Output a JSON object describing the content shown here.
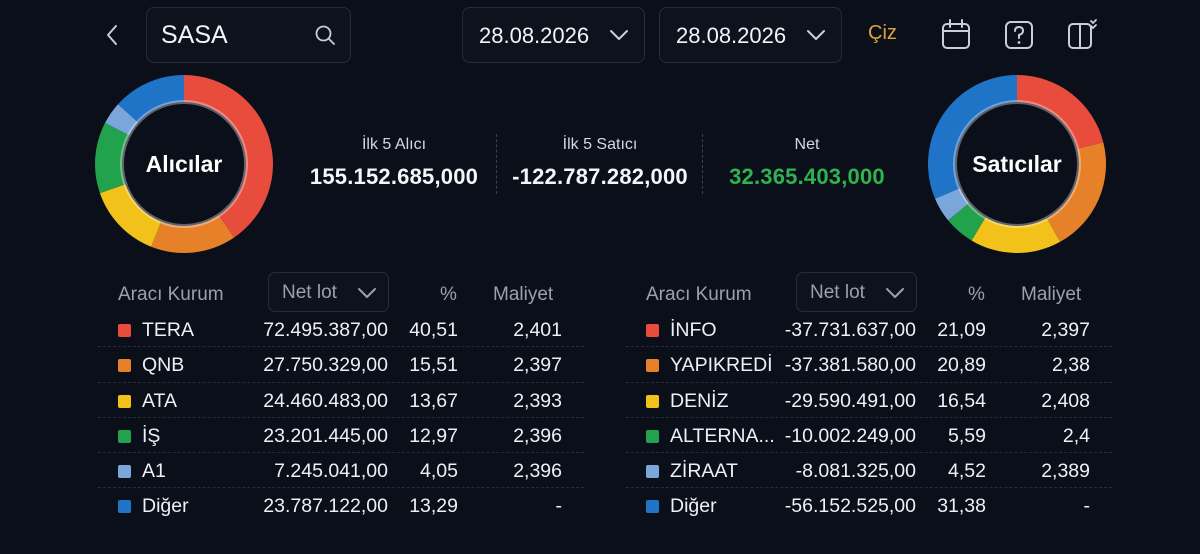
{
  "search": {
    "value": "SASA",
    "placeholder": ""
  },
  "dates": {
    "start": "28.08.2026",
    "end": "28.08.2026"
  },
  "actions": {
    "draw_label": "Çiz"
  },
  "icons": {
    "back": "chevron-left-icon",
    "search": "search-icon",
    "chevron": "chevron-down-icon",
    "calendar": "calendar-icon",
    "help": "help-icon",
    "layout": "layout-toggle-icon"
  },
  "colors": {
    "red": "#e84c3d",
    "orange": "#e6812a",
    "yellow": "#f2c21a",
    "green": "#23a24d",
    "light_blue": "#7aa6db",
    "blue": "#1f74c8",
    "accent_gold": "#d9a63a",
    "net_green": "#2fb24f"
  },
  "summary": {
    "buyers_label": "Alıcılar",
    "sellers_label": "Satıcılar",
    "top5_buyers_label": "İlk 5 Alıcı",
    "top5_buyers_value": "155.152.685,000",
    "top5_sellers_label": "İlk 5 Satıcı",
    "top5_sellers_value": "-122.787.282,000",
    "net_label": "Net",
    "net_value": "32.365.403,000"
  },
  "table_headers": {
    "broker": "Aracı Kurum",
    "net_lot": "Net lot",
    "percent": "%",
    "cost": "Maliyet"
  },
  "buyers": [
    {
      "name": "TERA",
      "net_lot": "72.495.387,00",
      "percent": "40,51",
      "cost": "2,401",
      "color": "#e84c3d",
      "pct": 40.51
    },
    {
      "name": "QNB",
      "net_lot": "27.750.329,00",
      "percent": "15,51",
      "cost": "2,397",
      "color": "#e6812a",
      "pct": 15.51
    },
    {
      "name": "ATA",
      "net_lot": "24.460.483,00",
      "percent": "13,67",
      "cost": "2,393",
      "color": "#f2c21a",
      "pct": 13.67
    },
    {
      "name": "İŞ",
      "net_lot": "23.201.445,00",
      "percent": "12,97",
      "cost": "2,396",
      "color": "#23a24d",
      "pct": 12.97
    },
    {
      "name": "A1",
      "net_lot": "7.245.041,00",
      "percent": "4,05",
      "cost": "2,396",
      "color": "#7aa6db",
      "pct": 4.05
    },
    {
      "name": "Diğer",
      "net_lot": "23.787.122,00",
      "percent": "13,29",
      "cost": "-",
      "color": "#1f74c8",
      "pct": 13.29
    }
  ],
  "sellers": [
    {
      "name": "İNFO",
      "net_lot": "-37.731.637,00",
      "percent": "21,09",
      "cost": "2,397",
      "color": "#e84c3d",
      "pct": 21.09
    },
    {
      "name": "YAPIKREDİ",
      "net_lot": "-37.381.580,00",
      "percent": "20,89",
      "cost": "2,38",
      "color": "#e6812a",
      "pct": 20.89
    },
    {
      "name": "DENİZ",
      "net_lot": "-29.590.491,00",
      "percent": "16,54",
      "cost": "2,408",
      "color": "#f2c21a",
      "pct": 16.54
    },
    {
      "name": "ALTERNA...",
      "net_lot": "-10.002.249,00",
      "percent": "5,59",
      "cost": "2,4",
      "color": "#23a24d",
      "pct": 5.59
    },
    {
      "name": "ZİRAAT",
      "net_lot": "-8.081.325,00",
      "percent": "4,52",
      "cost": "2,389",
      "color": "#7aa6db",
      "pct": 4.52
    },
    {
      "name": "Diğer",
      "net_lot": "-56.152.525,00",
      "percent": "31,38",
      "cost": "-",
      "color": "#1f74c8",
      "pct": 31.38
    }
  ]
}
